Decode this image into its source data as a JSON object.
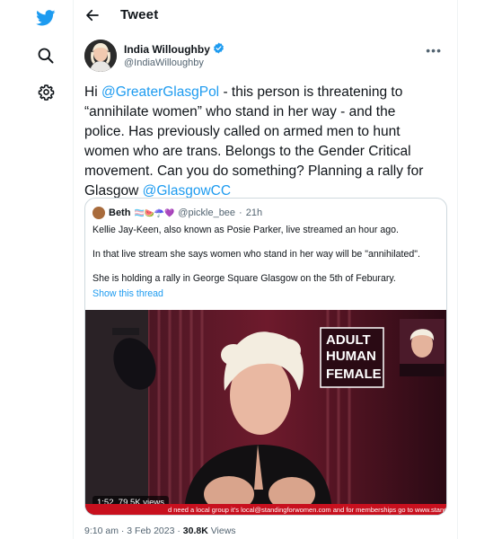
{
  "header": {
    "title": "Tweet"
  },
  "author": {
    "name": "India Willoughby",
    "handle": "@IndiaWilloughby"
  },
  "tweet": {
    "lines": [
      {
        "pre": "Hi ",
        "mention": "@GreaterGlasgPol",
        "post": " - this person is threatening to"
      },
      {
        "pre": "“annihilate women” who stand in her way - and the",
        "mention": "",
        "post": ""
      },
      {
        "pre": "police. Has previously called on armed men to hunt",
        "mention": "",
        "post": ""
      },
      {
        "pre": "women who are trans. Belongs to the Gender Critical",
        "mention": "",
        "post": ""
      },
      {
        "pre": "movement. Can you do something? Planning a rally for",
        "mention": "",
        "post": ""
      },
      {
        "pre": "Glasgow ",
        "mention": "@GlasgowCC",
        "post": ""
      }
    ]
  },
  "quote": {
    "name": "Beth",
    "emojis": "🏳️‍⚧️🍉☂️💜",
    "handle": "@pickle_bee",
    "separator": "·",
    "time": "21h",
    "paragraphs": [
      "Kellie Jay-Keen, also known as Posie Parker, live streamed an hour ago.",
      "In that live stream she says women who stand in her way will be \"annihilated\".",
      "She is holding a rally in George Square Glasgow on the 5th of Feburary."
    ],
    "show_thread": "Show this thread",
    "media": {
      "duration": "1:52",
      "views": "79.5K views",
      "sign_line1": "ADULT",
      "sign_line2": "HUMAN",
      "sign_line3": "FEMALE",
      "ticker": "d need a local group it's local@standingforwomen.com and for memberships go to www.stand"
    }
  },
  "footer": {
    "time": "9:10 am",
    "separator": "·",
    "date": "3 Feb 2023",
    "views_count": "30.8K",
    "views_label": "Views"
  },
  "colors": {
    "twitter_blue": "#1d9bf0",
    "text": "#0f1419",
    "muted": "#536471",
    "border": "#cfd9de"
  },
  "icons": [
    "twitter-bird-icon",
    "search-icon",
    "settings-gear-icon",
    "back-arrow-icon",
    "verified-badge-icon",
    "more-options-icon"
  ]
}
